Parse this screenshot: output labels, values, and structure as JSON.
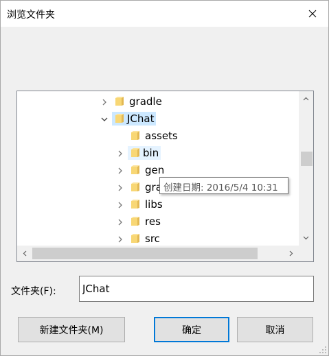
{
  "window": {
    "title": "浏览文件夹",
    "close_icon": "close-icon"
  },
  "tree": {
    "items": [
      {
        "label": "gradle",
        "expander": "collapsed",
        "level": 1,
        "selected": false
      },
      {
        "label": "JChat",
        "expander": "expanded",
        "level": 1,
        "selected": true
      },
      {
        "label": "assets",
        "expander": "none",
        "level": 2,
        "selected": false
      },
      {
        "label": "bin",
        "expander": "collapsed",
        "level": 2,
        "selected": false,
        "hovered": true
      },
      {
        "label": "gen",
        "expander": "collapsed",
        "level": 2,
        "selected": false
      },
      {
        "label": "gra",
        "expander": "collapsed",
        "level": 2,
        "selected": false
      },
      {
        "label": "libs",
        "expander": "collapsed",
        "level": 2,
        "selected": false
      },
      {
        "label": "res",
        "expander": "collapsed",
        "level": 2,
        "selected": false
      },
      {
        "label": "src",
        "expander": "collapsed",
        "level": 2,
        "selected": false
      }
    ],
    "folder_icon": "folder-icon",
    "folder_color": "#f8d775"
  },
  "tooltip": {
    "text": "创建日期: 2016/5/4 10:31"
  },
  "folder_field": {
    "label": "文件夹(F):",
    "value": "JChat"
  },
  "buttons": {
    "new_folder": "新建文件夹(M)",
    "ok": "确定",
    "cancel": "取消"
  },
  "colors": {
    "selection": "#cce8ff",
    "accent": "#0078d7"
  }
}
